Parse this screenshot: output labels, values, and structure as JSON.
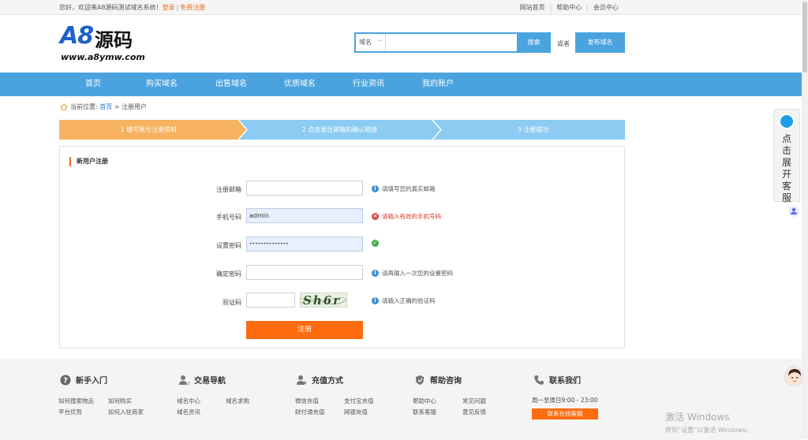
{
  "topbar": {
    "welcome": "您好，欢迎来A8源码测试域名系统！",
    "login": "登录",
    "divider": "|",
    "register": "免费注册",
    "links": [
      "网站首页",
      "帮助中心",
      "会员中心"
    ]
  },
  "logo": {
    "main": "A8",
    "cn": "源码",
    "url": "www.a8ymw.com"
  },
  "search": {
    "select_value": "域名",
    "placeholder": "",
    "button": "搜索"
  },
  "or_text": "或者",
  "publish_button": "发布域名",
  "nav": [
    "首页",
    "购买域名",
    "出售域名",
    "优质域名",
    "行业资讯",
    "我的账户"
  ],
  "breadcrumb": {
    "prefix": "当前位置:",
    "home": "首页",
    "sep": ">",
    "current": "注册用户"
  },
  "steps": [
    "1 填写账号注册资料",
    "2 点击发往邮箱的确认链接",
    "3 注册成功"
  ],
  "form": {
    "title": "新用户注册",
    "email_label": "注册邮箱",
    "email_value": "",
    "email_hint": "请填写您的真实邮箱",
    "phone_label": "手机号码",
    "phone_value": "admin",
    "phone_hint": "请输入有效的手机号码",
    "password_label": "设置密码",
    "password_value": "••••••••••••••",
    "confirm_label": "确定密码",
    "confirm_value": "",
    "confirm_hint": "请再输入一次您的设置密码",
    "captcha_label": "验证码",
    "captcha_value": "",
    "captcha_image_text": "Sh6r",
    "captcha_hint": "请输入正确的验证码",
    "submit": "注册"
  },
  "footer": {
    "columns": [
      {
        "title": "新手入门",
        "links": [
          "如何搜索物品",
          "如何购买",
          "平台优势",
          "如何入驻商家"
        ]
      },
      {
        "title": "交易导航",
        "links": [
          "域名中心",
          "域名求购",
          "域名资讯"
        ]
      },
      {
        "title": "充值方式",
        "links": [
          "微信充值",
          "支付宝充值",
          "财付通充值",
          "网银充值"
        ]
      },
      {
        "title": "帮助咨询",
        "links": [
          "帮助中心",
          "常见问题",
          "联系客服",
          "意见反馈"
        ]
      },
      {
        "title": "联系我们",
        "links": []
      }
    ],
    "contact_time": "周一至周日9:00 - 23:00",
    "contact_button": "联系在线客服"
  },
  "float": {
    "cs_text": "点击展开客服"
  },
  "watermark": {
    "line1": "激活 Windows",
    "line2": "转到“设置”以激活 Windows。"
  },
  "colors": {
    "accent": "#4aa3df",
    "orange": "#ff6b0f",
    "step_active": "#f6b25f"
  }
}
